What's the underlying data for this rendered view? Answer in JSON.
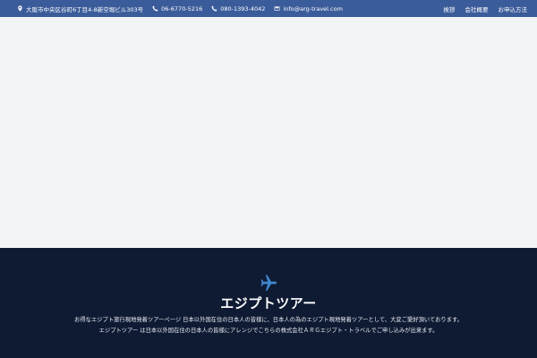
{
  "topbar": {
    "address": "大阪市中央区谷町6丁目4-8新空堀ビル303号",
    "phone": "06-6770-5216",
    "mobile": "080-1393-4042",
    "email": "info@arg-travel.com",
    "nav": {
      "greeting": "挨拶",
      "company": "会社概要",
      "apply": "お申込方法"
    }
  },
  "icons": {
    "address": "map-marker-icon",
    "phone": "phone-icon",
    "mobile": "phone-icon",
    "email": "envelope-icon",
    "footer": "airplane-icon"
  },
  "footer": {
    "title": "エジプトツアー",
    "line1": "お得なエジプト旅行現地発着ツアーページ 日本以外国在住の日本人の皆様に、日本人の為のエジプト現地発着ツアーとして、大変ご愛好頂いております。",
    "line2": "エジプトツアー は日本以外国在住の日本人の皆様にアレンジでこちらの株式会社ＡＲＧエジプト・トラベルでご申し込みが出来ます。"
  },
  "colors": {
    "topbar": "#3b5c9a",
    "hero": "#f3f4f6",
    "footer": "#0f1b33",
    "icon_accent": "#3f86cf"
  }
}
